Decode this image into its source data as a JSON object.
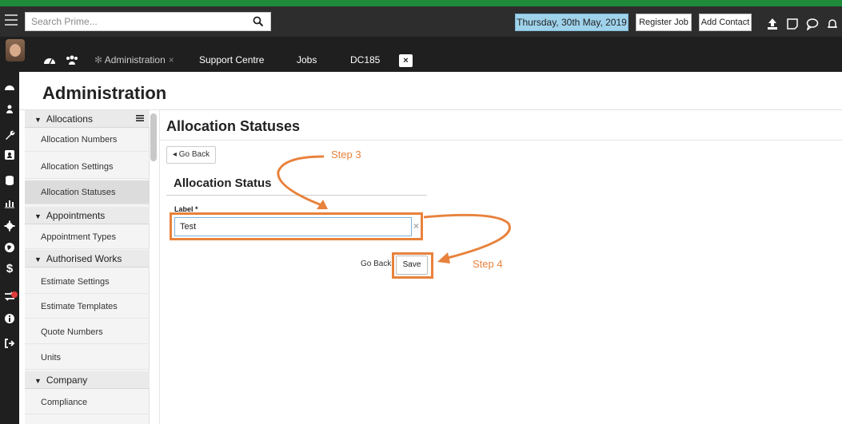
{
  "topbar": {
    "search_placeholder": "Search Prime...",
    "date": "Thursday, 30th May, 2019",
    "register_job": "Register Job",
    "add_contact": "Add Contact"
  },
  "tabs": {
    "administration": "Administration",
    "administration_close": "×",
    "support_centre": "Support Centre",
    "jobs": "Jobs",
    "dc185": "DC185",
    "close_box": "×"
  },
  "page": {
    "title": "Administration"
  },
  "menu": {
    "sections": [
      {
        "label": "Allocations",
        "items": [
          "Allocation Numbers",
          "Allocation Settings",
          "Allocation Statuses"
        ]
      },
      {
        "label": "Appointments",
        "items": [
          "Appointment Types"
        ]
      },
      {
        "label": "Authorised Works",
        "items": [
          "Estimate Settings",
          "Estimate Templates",
          "Quote Numbers",
          "Units"
        ]
      },
      {
        "label": "Company",
        "items": [
          "Compliance"
        ]
      }
    ],
    "active_item": "Allocation Statuses"
  },
  "content": {
    "section_title": "Allocation Statuses",
    "go_back_button": "◂ Go Back",
    "form_title": "Allocation Status",
    "label_field_label": "Label *",
    "label_field_value": "Test",
    "clear": "×",
    "go_back_link": "Go Back",
    "save": "Save"
  },
  "annotations": {
    "step3": "Step 3",
    "step4": "Step 4",
    "color": "#e8823c"
  },
  "icons": [
    "hamburger-icon",
    "search-icon",
    "upload-icon",
    "note-icon",
    "chat-icon",
    "bell-icon",
    "dashboard-icon",
    "users-icon",
    "wrench-icon",
    "contact-card-icon",
    "database-icon",
    "bar-chart-icon",
    "gear-icon",
    "globe-icon",
    "dollar-icon",
    "transfer-icon",
    "info-icon",
    "logout-icon",
    "list-icon"
  ],
  "colors": {
    "topbar": "#2d2d2d",
    "accent_green": "#1f8a3a",
    "date_button": "#9fd3ec",
    "annotation": "#e8823c"
  }
}
